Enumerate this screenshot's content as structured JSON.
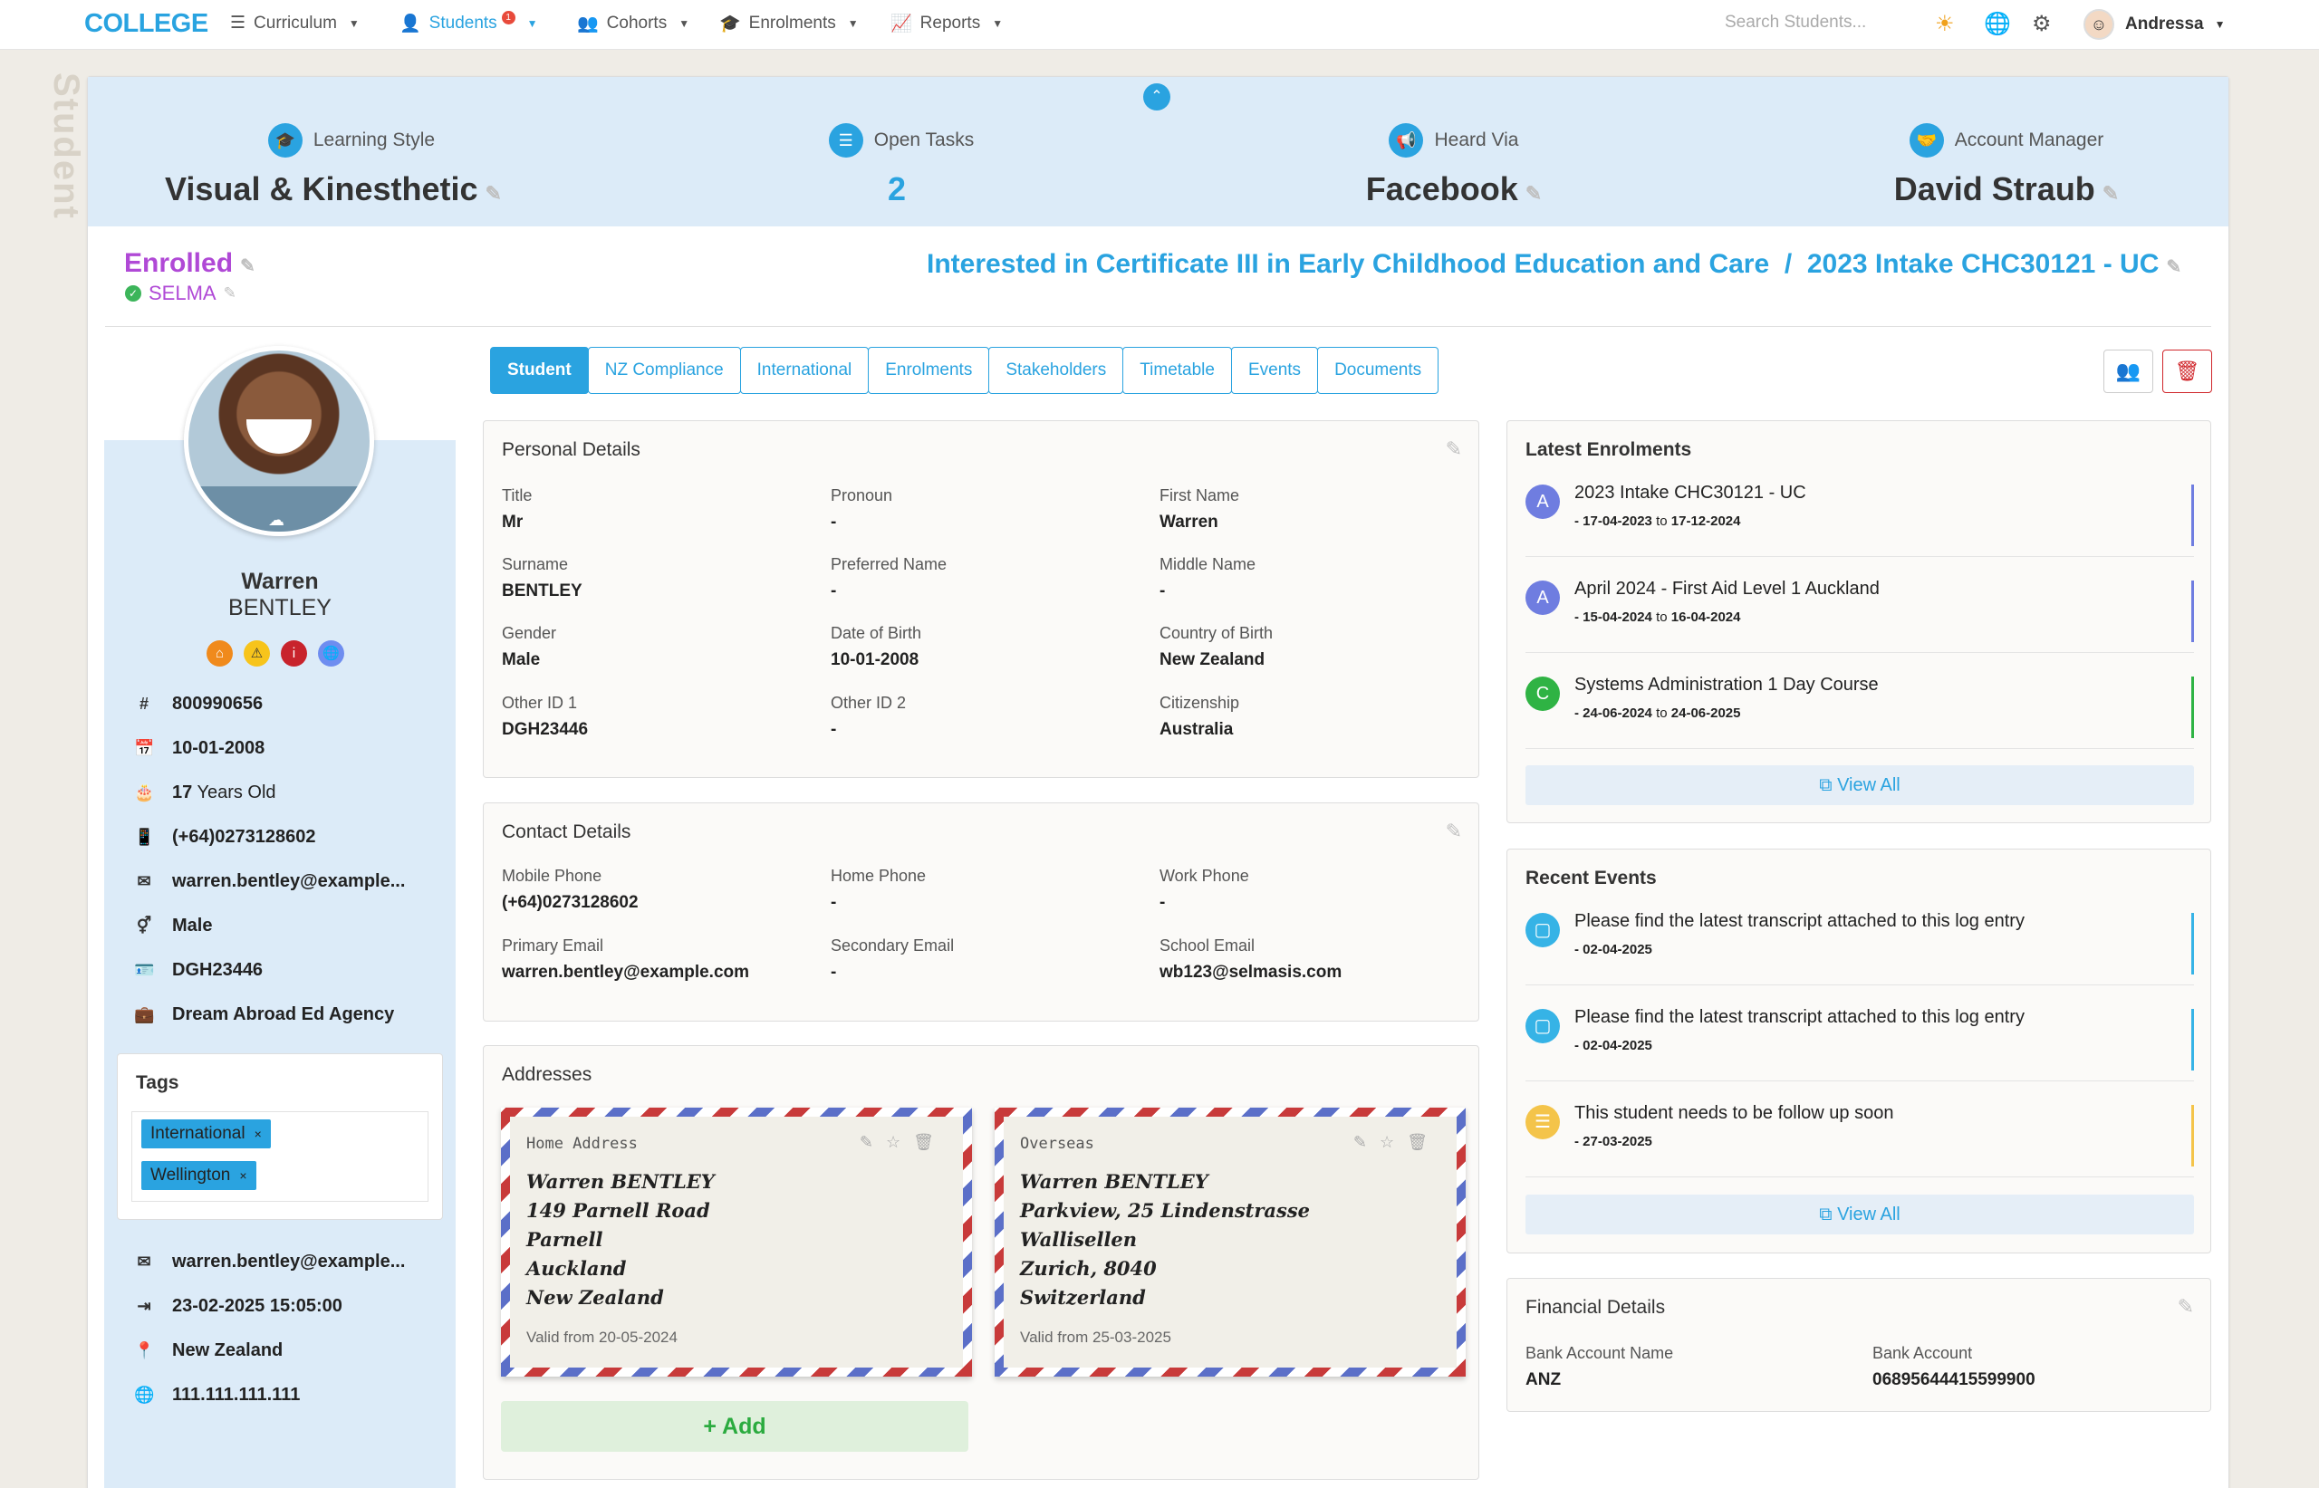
{
  "nav": {
    "logo": "COLLEGE",
    "items": [
      {
        "label": "Curriculum"
      },
      {
        "label": "Students",
        "badge": "1"
      },
      {
        "label": "Cohorts"
      },
      {
        "label": "Enrolments"
      },
      {
        "label": "Reports"
      }
    ],
    "search_placeholder": "Search Students...",
    "user": "Andressa"
  },
  "side_label": "Student",
  "stats": [
    {
      "label": "Learning Style",
      "value": "Visual & Kinesthetic"
    },
    {
      "label": "Open Tasks",
      "value": "2"
    },
    {
      "label": "Heard Via",
      "value": "Facebook"
    },
    {
      "label": "Account Manager",
      "value": "David Straub"
    }
  ],
  "status": "Enrolled",
  "org": "SELMA",
  "interest": "Interested in Certificate III in Early Childhood Education and Care  /  2023 Intake CHC30121 - UC",
  "student": {
    "first": "Warren",
    "last": "BENTLEY",
    "info": [
      "800990656",
      "10-01-2008",
      "17 Years Old",
      "(+64)0273128602",
      "warren.bentley@example...",
      "Male",
      "DGH23446",
      "Dream Abroad Ed Agency"
    ],
    "info2": [
      "warren.bentley@example...",
      "23-02-2025 15:05:00",
      "New Zealand",
      "111.111.111.111"
    ],
    "age_num": "17",
    "age_rest": " Years Old"
  },
  "tags": {
    "title": "Tags",
    "items": [
      "International",
      "Wellington"
    ],
    "remove": "×"
  },
  "tabs": [
    "Student",
    "NZ Compliance",
    "International",
    "Enrolments",
    "Stakeholders",
    "Timetable",
    "Events",
    "Documents"
  ],
  "personal": {
    "title": "Personal Details",
    "fields": [
      {
        "k": "Title",
        "v": "Mr"
      },
      {
        "k": "Pronoun",
        "v": "-"
      },
      {
        "k": "First Name",
        "v": "Warren"
      },
      {
        "k": "Surname",
        "v": "BENTLEY"
      },
      {
        "k": "Preferred Name",
        "v": "-"
      },
      {
        "k": "Middle Name",
        "v": "-"
      },
      {
        "k": "Gender",
        "v": "Male"
      },
      {
        "k": "Date of Birth",
        "v": "10-01-2008"
      },
      {
        "k": "Country of Birth",
        "v": "New Zealand"
      },
      {
        "k": "Other ID 1",
        "v": "DGH23446"
      },
      {
        "k": "Other ID 2",
        "v": "-"
      },
      {
        "k": "Citizenship",
        "v": "Australia"
      }
    ]
  },
  "contact": {
    "title": "Contact Details",
    "fields": [
      {
        "k": "Mobile Phone",
        "v": "(+64)0273128602"
      },
      {
        "k": "Home Phone",
        "v": "-"
      },
      {
        "k": "Work Phone",
        "v": "-"
      },
      {
        "k": "Primary Email",
        "v": "warren.bentley@example.com"
      },
      {
        "k": "Secondary Email",
        "v": "-"
      },
      {
        "k": "School Email",
        "v": "wb123@selmasis.com"
      }
    ]
  },
  "addresses": {
    "title": "Addresses",
    "items": [
      {
        "type": "Home Address",
        "lines": [
          "Warren BENTLEY",
          "149 Parnell Road",
          "Parnell",
          "Auckland",
          "New Zealand"
        ],
        "valid": "Valid from 20-05-2024"
      },
      {
        "type": "Overseas",
        "lines": [
          "Warren BENTLEY",
          "Parkview, 25 Lindenstrasse",
          "Wallisellen",
          "Zurich, 8040",
          "Switzerland"
        ],
        "valid": "Valid from 25-03-2025"
      }
    ],
    "add_label": "+ Add"
  },
  "latest_enrolments": {
    "title": "Latest Enrolments",
    "items": [
      {
        "letter": "A",
        "title": "2023 Intake CHC30121 - UC",
        "from": "- 17-04-2023",
        "to": "17-12-2024",
        "color": "#6f7de0"
      },
      {
        "letter": "A",
        "title": "April 2024 - First Aid Level 1 Auckland",
        "from": "- 15-04-2024",
        "to": "16-04-2024",
        "color": "#6f7de0"
      },
      {
        "letter": "C",
        "title": "Systems Administration 1 Day Course",
        "from": "- 24-06-2024",
        "to": "24-06-2025",
        "color": "#2fb344"
      }
    ],
    "to_word": "to",
    "view_all": "View All"
  },
  "recent_events": {
    "title": "Recent Events",
    "items": [
      {
        "title": "Please find the latest transcript attached to this log entry",
        "date": "- 02-04-2025",
        "color": "#36b3e6"
      },
      {
        "title": "Please find the latest transcript attached to this log entry",
        "date": "- 02-04-2025",
        "color": "#36b3e6"
      },
      {
        "title": "This student needs to be follow up soon",
        "date": "- 27-03-2025",
        "color": "#f4c44a"
      }
    ],
    "view_all": "View All"
  },
  "financial": {
    "title": "Financial Details",
    "fields": [
      {
        "k": "Bank Account Name",
        "v": "ANZ"
      },
      {
        "k": "Bank Account",
        "v": "06895644415599900"
      }
    ]
  }
}
